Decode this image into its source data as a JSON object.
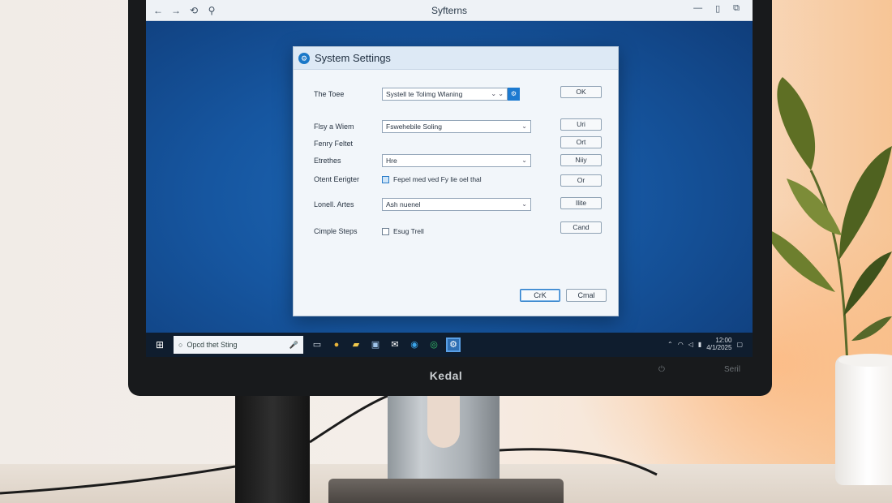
{
  "window": {
    "title": "Syfterns",
    "nav": {
      "back": "←",
      "forward": "→",
      "refresh": "⟲",
      "pin": "⚲"
    },
    "controls": {
      "minimize": "—",
      "maximize": "▯",
      "restore": "⧉"
    }
  },
  "dialog": {
    "title": "System Settings",
    "rows": [
      {
        "label": "The Toee",
        "type": "select",
        "value": "Systell te Tolimg Wlaning"
      },
      {
        "label": "Flsy a Wiem",
        "type": "select",
        "value": "Fswehebile Soling"
      },
      {
        "label": "Fenry Feltet",
        "type": "none"
      },
      {
        "label": "Etrethes",
        "type": "select",
        "value": "Hre"
      },
      {
        "label": "Otent Eerigter",
        "type": "checkbox",
        "value": "Fepel med ved Fy lie oel thal",
        "checked": true
      },
      {
        "label": "Lonell. Artes",
        "type": "select",
        "value": "Ash nuenel"
      },
      {
        "label": "Cimple Steps",
        "type": "checkbox",
        "value": "Esug Trell",
        "checked": false
      }
    ],
    "side_buttons": [
      "OK",
      "Uri",
      "Ort",
      "Niiy",
      "Or",
      "Ilite",
      "Cand"
    ],
    "footer": {
      "ok": "CrK",
      "cancel": "Cmal"
    }
  },
  "taskbar": {
    "search_text": "Opcd thet Sting",
    "clock": {
      "time": "12:00",
      "date": "4/1/2025"
    }
  },
  "monitor": {
    "brand": "Kedal",
    "control_label": "Seril"
  },
  "colors": {
    "accent": "#1d7ad0",
    "desktop": "#1656a0",
    "taskbar": "#0f1d2e"
  },
  "icons": [
    "back-arrow-icon",
    "forward-arrow-icon",
    "refresh-icon",
    "pin-icon",
    "settings-icon",
    "windows-start-icon",
    "search-icon",
    "mic-icon",
    "chevron-down-icon",
    "checkbox-icon",
    "wifi-icon",
    "volume-icon",
    "battery-icon",
    "notification-icon"
  ]
}
